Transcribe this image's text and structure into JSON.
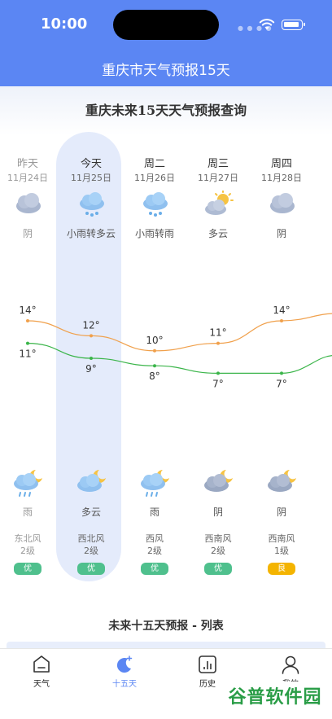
{
  "status_bar": {
    "time": "10:00"
  },
  "header": {
    "title": "重庆市天气预报15天"
  },
  "section_title": "重庆未来15天天气预报查询",
  "days": [
    {
      "name": "昨天",
      "date": "11月24日",
      "day_weather": "阴",
      "day_icon": "cloudy-icon",
      "high": "14°",
      "high_value": 14,
      "low": "11°",
      "low_value": 11,
      "night_weather": "雨",
      "night_icon": "night-rain-icon",
      "wind_dir": "东北风",
      "wind_level": "2级",
      "aqi": "优",
      "aqi_color": "#4fc08d",
      "past": true
    },
    {
      "name": "今天",
      "date": "11月25日",
      "day_weather": "小雨转多云",
      "day_icon": "light-rain-icon",
      "high": "12°",
      "high_value": 12,
      "low": "9°",
      "low_value": 9,
      "night_weather": "多云",
      "night_icon": "night-cloudy-icon",
      "wind_dir": "西北风",
      "wind_level": "2级",
      "aqi": "优",
      "aqi_color": "#4fc08d",
      "past": false
    },
    {
      "name": "周二",
      "date": "11月26日",
      "day_weather": "小雨转雨",
      "day_icon": "light-rain-icon",
      "high": "10°",
      "high_value": 10,
      "low": "8°",
      "low_value": 8,
      "night_weather": "雨",
      "night_icon": "night-rain-icon",
      "wind_dir": "西风",
      "wind_level": "2级",
      "aqi": "优",
      "aqi_color": "#4fc08d",
      "past": false
    },
    {
      "name": "周三",
      "date": "11月27日",
      "day_weather": "多云",
      "day_icon": "partly-cloudy-icon",
      "high": "11°",
      "high_value": 11,
      "low": "7°",
      "low_value": 7,
      "night_weather": "阴",
      "night_icon": "night-overcast-icon",
      "wind_dir": "西南风",
      "wind_level": "2级",
      "aqi": "优",
      "aqi_color": "#4fc08d",
      "past": false
    },
    {
      "name": "周四",
      "date": "11月28日",
      "day_weather": "阴",
      "day_icon": "cloudy-icon",
      "high": "14°",
      "high_value": 14,
      "low": "7°",
      "low_value": 7,
      "night_weather": "阴",
      "night_icon": "night-overcast-icon",
      "wind_dir": "西南风",
      "wind_level": "1级",
      "aqi": "良",
      "aqi_color": "#f4b400",
      "past": false
    }
  ],
  "colors": {
    "accent": "#5b86f3",
    "high_line": "#f0a04b",
    "low_line": "#3bb54a"
  },
  "list_title": "未来十五天预报 - 列表",
  "tabs": [
    {
      "label": "天气",
      "icon": "home-icon",
      "active": false
    },
    {
      "label": "十五天",
      "icon": "moon-icon",
      "active": true
    },
    {
      "label": "历史",
      "icon": "chart-icon",
      "active": false
    },
    {
      "label": "我的",
      "icon": "user-icon",
      "active": false
    }
  ],
  "watermark": "谷普软件园"
}
